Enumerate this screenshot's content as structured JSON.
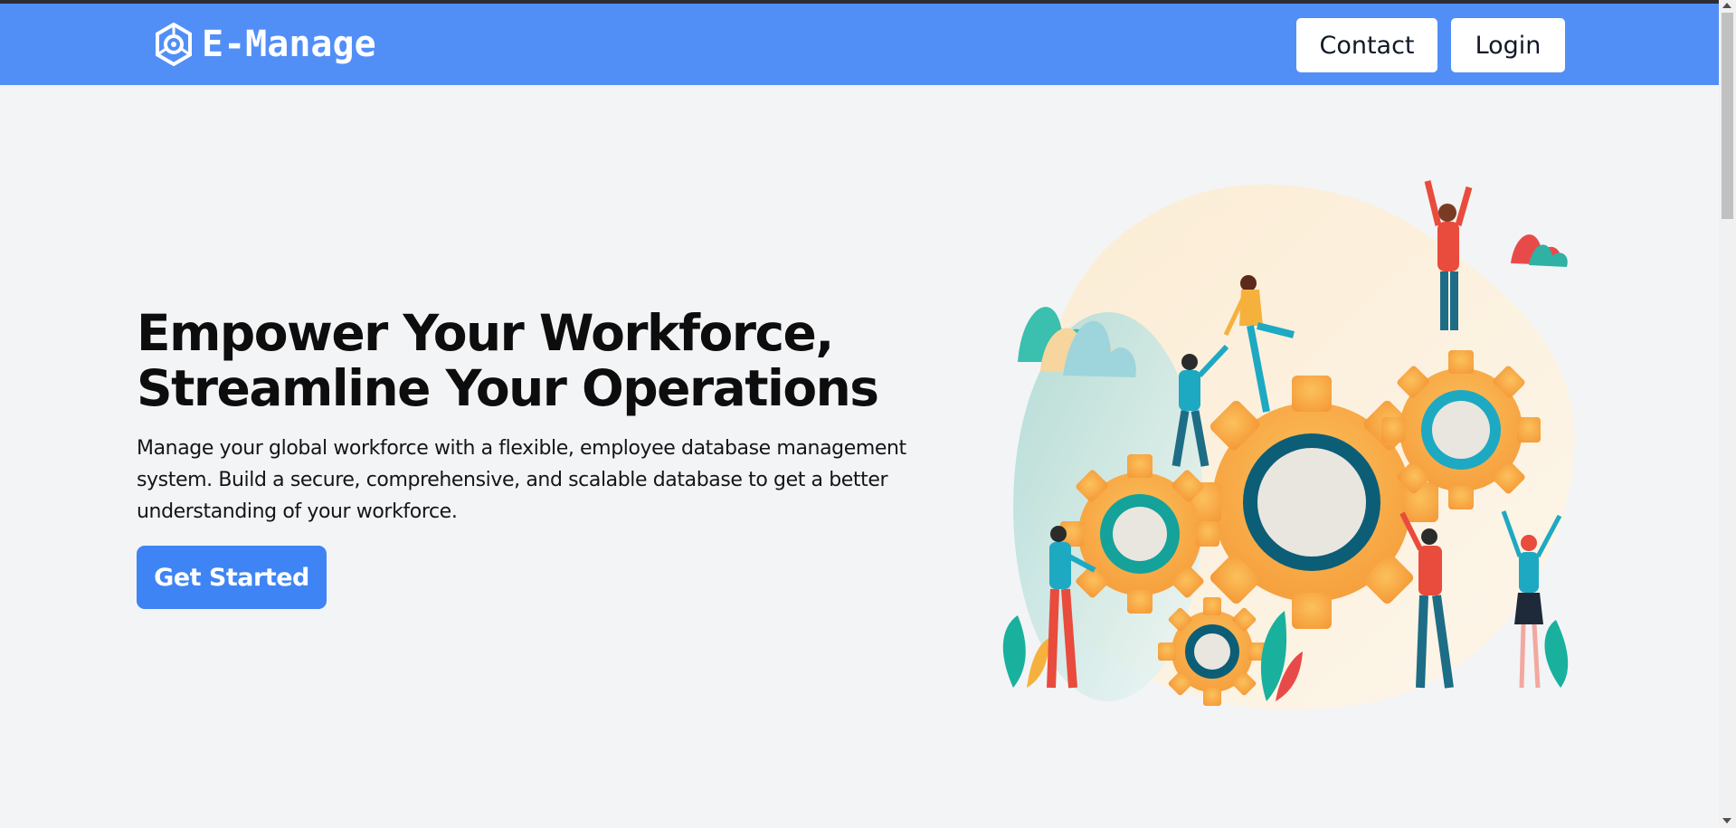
{
  "brand": {
    "name": "E-Manage",
    "icon": "hexagon-logo-icon"
  },
  "nav": {
    "contact_label": "Contact",
    "login_label": "Login"
  },
  "hero": {
    "title_line1": "Empower Your Workforce,",
    "title_line2": "Streamline Your Operations",
    "description": "Manage your global workforce with a flexible, employee database management system. Build a secure, comprehensive, and scalable database to get a better understanding of your workforce.",
    "cta_label": "Get Started"
  },
  "illustration": {
    "icon": "teamwork-gears-illustration"
  },
  "colors": {
    "navbar": "#518ff7",
    "cta": "#3f84f4",
    "background": "#f3f4f6",
    "gear_orange": "#f7a83a",
    "gear_teal": "#0c5e76"
  }
}
